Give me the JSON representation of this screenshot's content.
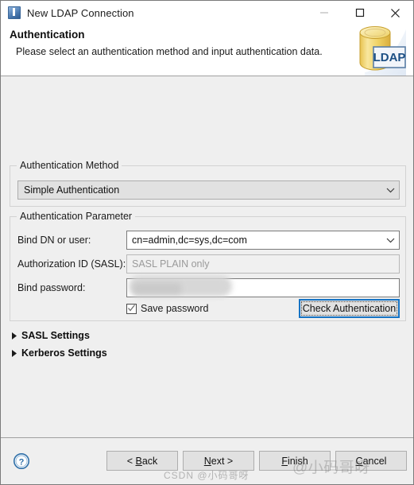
{
  "window": {
    "title": "New LDAP Connection",
    "app_icon": "ldap-app-icon",
    "controls": {
      "minimize": "minimize-icon",
      "maximize": "maximize-icon",
      "close": "close-icon"
    }
  },
  "header": {
    "title": "Authentication",
    "description": "Please select an authentication method and input authentication data.",
    "icon_label": "LDAP"
  },
  "auth_method": {
    "group_title": "Authentication Method",
    "selected": "Simple Authentication"
  },
  "auth_parameter": {
    "group_title": "Authentication Parameter",
    "bind_dn_label": "Bind DN or user:",
    "bind_dn_value": "cn=admin,dc=sys,dc=com",
    "authz_label": "Authorization ID (SASL):",
    "authz_placeholder": "SASL PLAIN only",
    "authz_value": "",
    "bind_password_label": "Bind password:",
    "bind_password_value": "",
    "save_password_label": "Save password",
    "save_password_checked": true,
    "check_authentication_label": "Check Authentication"
  },
  "sections": [
    {
      "label": "SASL Settings",
      "expanded": false
    },
    {
      "label": "Kerberos Settings",
      "expanded": false
    }
  ],
  "buttonbar": {
    "help": "help-icon",
    "buttons": [
      {
        "label": "< Back",
        "mnemonic": "B"
      },
      {
        "label": "Next >",
        "mnemonic": "N"
      },
      {
        "label": "Finish",
        "mnemonic": "F"
      },
      {
        "label": "Cancel",
        "mnemonic": "C"
      }
    ]
  },
  "watermark": {
    "primary": "@小码哥呀",
    "secondary": "CSDN @小码哥呀"
  },
  "colors": {
    "dialog_bg": "#efefef",
    "header_bg": "#ffffff",
    "focus_border": "#1673c4",
    "field_bg": "#ffffff",
    "disabled_field_bg": "#f0f0f0",
    "button_bg": "#e1e1e1",
    "ldap_icon_yellow": "#f2d46a"
  }
}
